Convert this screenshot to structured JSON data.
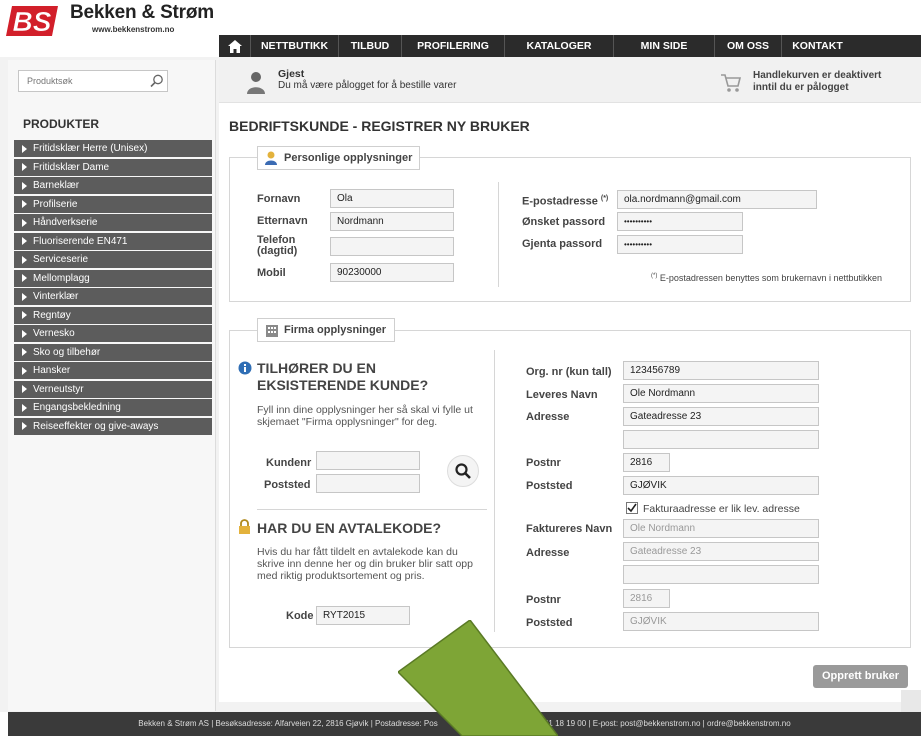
{
  "brand": {
    "logo_mark": "BS",
    "name": "Bekken & Strøm",
    "url": "www.bekkenstrom.no",
    "colors": {
      "logo_red": "#d21f2a",
      "nav_bg": "#2b2b2b",
      "sidebar_item_bg": "#5c5c5c",
      "arrow_fill": "#7ea536"
    }
  },
  "nav": {
    "home_icon": "home-icon",
    "items": [
      "NETTBUTIKK",
      "TILBUD",
      "PROFILERING",
      "KATALOGER",
      "MIN SIDE",
      "OM OSS",
      "KONTAKT"
    ]
  },
  "search": {
    "placeholder": "Produktsøk",
    "icon": "search-icon"
  },
  "sidebar": {
    "heading": "PRODUKTER",
    "items": [
      "Fritidsklær Herre (Unisex)",
      "Fritidsklær Dame",
      "Barneklær",
      "Profilserie",
      "Håndverkserie",
      "Fluoriserende EN471",
      "Serviceserie",
      "Mellomplagg",
      "Vinterklær",
      "Regntøy",
      "Vernesko",
      "Sko og tilbehør",
      "Hansker",
      "Verneutstyr",
      "Engangsbekledning",
      "Reiseeffekter og give-aways"
    ]
  },
  "user_bar": {
    "title": "Gjest",
    "text": "Du må være pålogget for å bestille varer"
  },
  "cart_bar": {
    "line1": "Handlekurven er deaktivert",
    "line2": "inntil du er pålogget"
  },
  "page": {
    "title": "BEDRIFTSKUNDE - REGISTRER NY BRUKER"
  },
  "personal": {
    "legend": "Personlige opplysninger",
    "first_name": {
      "label": "Fornavn",
      "value": "Ola"
    },
    "last_name": {
      "label": "Etternavn",
      "value": "Nordmann"
    },
    "phone": {
      "label1": "Telefon",
      "label2": "(dagtid)",
      "value": ""
    },
    "mobile": {
      "label": "Mobil",
      "value": "90230000"
    },
    "email": {
      "label": "E-postadresse",
      "mark": "(*)",
      "value": "ola.nordmann@gmail.com"
    },
    "password": {
      "label": "Ønsket passord",
      "value": "••••••••••"
    },
    "password_repeat": {
      "label": "Gjenta passord",
      "value": "••••••••••"
    },
    "note_mark": "(*)",
    "note": "E-postadressen benyttes som brukernavn i nettbutikken"
  },
  "company": {
    "legend": "Firma opplysninger",
    "existing": {
      "heading1": "TILHØRER DU EN",
      "heading2": "EKSISTERENDE KUNDE?",
      "text1": "Fyll inn dine opplysninger her så skal vi fylle ut",
      "text2": "skjemaet \"Firma opplysninger\" for deg.",
      "customer_no_label": "Kundenr",
      "customer_no_value": "",
      "city_label": "Poststed",
      "city_value": ""
    },
    "agreement": {
      "heading": "HAR DU EN AVTALEKODE?",
      "text1": "Hvis du har fått tildelt en avtalekode kan du",
      "text2": "skrive inn denne her og din bruker blir satt opp",
      "text3": "med riktig produktsortement og pris.",
      "code_label": "Kode",
      "code_value": "RYT2015"
    },
    "org_no": {
      "label": "Org. nr (kun tall)",
      "value": "123456789"
    },
    "delivery_name": {
      "label": "Leveres Navn",
      "value": "Ole Nordmann"
    },
    "address": {
      "label": "Adresse",
      "value": "Gateadresse 23",
      "value2": ""
    },
    "postcode": {
      "label": "Postnr",
      "value": "2816"
    },
    "city": {
      "label": "Poststed",
      "value": "GJØVIK"
    },
    "invoice_same": {
      "label": "Fakturaadresse er lik lev. adresse",
      "checked": true
    },
    "invoice_name": {
      "label": "Faktureres Navn",
      "value": "Ole Nordmann"
    },
    "invoice_address": {
      "label": "Adresse",
      "value": "Gateadresse 23",
      "value2": ""
    },
    "invoice_postcode": {
      "label": "Postnr",
      "value": "2816"
    },
    "invoice_city": {
      "label": "Poststed",
      "value": "GJØVIK"
    }
  },
  "submit_label": "Opprett bruker",
  "footer": {
    "left": "Bekken & Strøm AS | Besøksadresse: Alfarveien 22, 2816 Gjøvik | Postadresse: Pos",
    "right": "elefon: 61 18 19 00 | E-post: post@bekkenstrom.no | ordre@bekkenstrom.no"
  }
}
